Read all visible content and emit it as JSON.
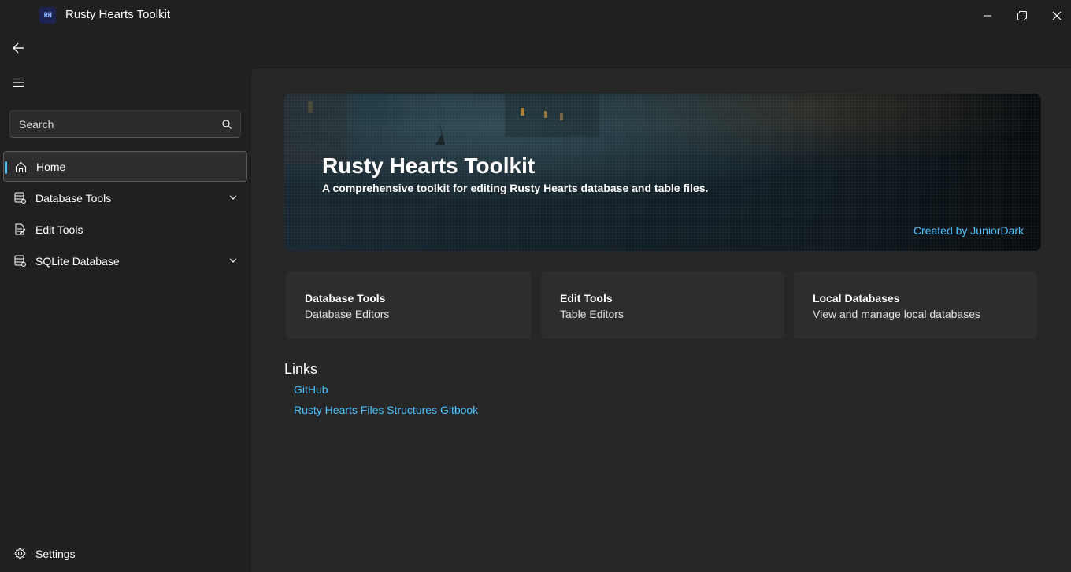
{
  "window": {
    "title": "Rusty Hearts Toolkit",
    "logo_text": "RH"
  },
  "search": {
    "placeholder": "Search"
  },
  "nav": {
    "items": [
      {
        "label": "Home",
        "icon": "home-icon",
        "selected": true
      },
      {
        "label": "Database Tools",
        "icon": "database-icon",
        "expandable": true
      },
      {
        "label": "Edit Tools",
        "icon": "document-edit-icon"
      },
      {
        "label": "SQLite Database",
        "icon": "database-icon",
        "expandable": true
      }
    ],
    "settings_label": "Settings"
  },
  "hero": {
    "title": "Rusty Hearts Toolkit",
    "subtitle": "A comprehensive toolkit for editing Rusty Hearts database and table files.",
    "credit": "Created by JuniorDark"
  },
  "cards": [
    {
      "title": "Database Tools",
      "subtitle": "Database Editors"
    },
    {
      "title": "Edit Tools",
      "subtitle": "Table Editors"
    },
    {
      "title": "Local Databases",
      "subtitle": "View and manage local databases"
    }
  ],
  "links": {
    "heading": "Links",
    "items": [
      {
        "label": "GitHub"
      },
      {
        "label": "Rusty Hearts Files Structures Gitbook"
      }
    ]
  },
  "colors": {
    "accent": "#4cc2ff",
    "background": "#202020",
    "content": "#272727",
    "card": "#2d2d2d"
  }
}
